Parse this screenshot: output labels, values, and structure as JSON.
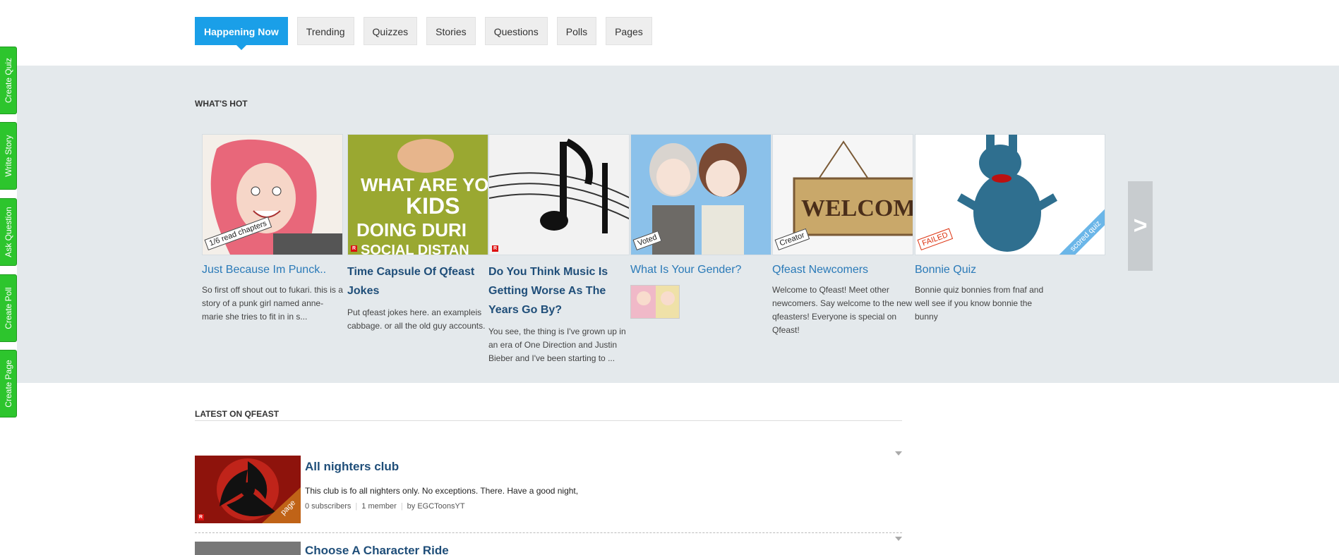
{
  "tabs": [
    {
      "label": "Happening Now",
      "active": true
    },
    {
      "label": "Trending"
    },
    {
      "label": "Quizzes"
    },
    {
      "label": "Stories"
    },
    {
      "label": "Questions"
    },
    {
      "label": "Polls"
    },
    {
      "label": "Pages"
    }
  ],
  "side_buttons": [
    "Create Quiz",
    "Write Story",
    "Ask Question",
    "Create Poll",
    "Create Page"
  ],
  "whats_hot": {
    "title": "WHAT'S HOT",
    "next_label": ">",
    "cards": [
      {
        "title": "Just Because Im Punck..",
        "badge": "1/6 read chapters",
        "desc": "So first off shout out to fukari. this is a story of a punk girl named anne-marie she tries to fit in in s..."
      },
      {
        "title": "Time Capsule Of Qfeast Jokes",
        "image_text": [
          "WHAT ARE YO",
          "KIDS",
          "DOING DURI",
          "SOCIAL DISTAN"
        ],
        "desc": "Put qfeast jokes here. an exampleis cabbage. or all the old guy accounts."
      },
      {
        "title": "Do You Think Music Is Getting Worse As The Years Go By?",
        "desc": "You see, the thing is I've grown up in an era of One Direction and Justin Bieber and I've been starting to ..."
      },
      {
        "title": "What Is Your Gender?",
        "badge": "Voted"
      },
      {
        "title": "Qfeast Newcomers",
        "badge": "Creator",
        "image_text": [
          "WELCOM"
        ],
        "desc": "Welcome to Qfeast! Meet other newcomers. Say welcome to the new qfeasters! Everyone is special on Qfeast!"
      },
      {
        "title": "Bonnie Quiz",
        "badge": "FAILED",
        "ribbon": "scored quiz",
        "desc": "Bonnie quiz bonnies from fnaf and well see if you know bonnie the bunny"
      }
    ]
  },
  "latest": {
    "title": "LATEST ON QFEAST",
    "items": [
      {
        "title": "All nighters club",
        "desc": "This club is fo all nighters only. No exceptions. There. Have a good night,",
        "subscribers": "0 subscribers",
        "members": "1 member",
        "author": "by EGCToonsYT",
        "ribbon": "page"
      },
      {
        "title": "Choose A Character Ride"
      }
    ]
  },
  "colors": {
    "accent": "#1a9fe8",
    "side_green": "#2dc52d",
    "band": "#e4e9ec",
    "link": "#2a7ab8",
    "title_dark": "#1f4e79"
  }
}
